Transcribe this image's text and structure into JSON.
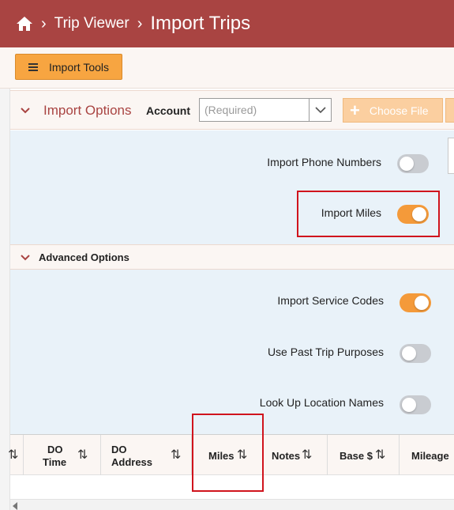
{
  "header": {
    "breadcrumb": [
      "Trip Viewer"
    ],
    "title": "Import Trips"
  },
  "toolbar": {
    "tools_label": "Import Tools"
  },
  "import_options": {
    "title": "Import Options",
    "account_label": "Account",
    "account_placeholder": "(Required)",
    "choose_file_label": "Choose File",
    "toggles": [
      {
        "label": "Import Phone Numbers",
        "on": false
      },
      {
        "label": "Import Miles",
        "on": true
      }
    ]
  },
  "advanced_options": {
    "title": "Advanced Options",
    "toggles": [
      {
        "label": "Import Service Codes",
        "on": true
      },
      {
        "label": "Use Past Trip Purposes",
        "on": false
      },
      {
        "label": "Look Up Location Names",
        "on": false
      }
    ]
  },
  "grid": {
    "columns": [
      {
        "line1": "DO",
        "line2": "Time"
      },
      {
        "line1": "DO",
        "line2": "Address"
      },
      {
        "line1": "Miles",
        "line2": ""
      },
      {
        "line1": "Notes",
        "line2": ""
      },
      {
        "line1": "Base $",
        "line2": ""
      },
      {
        "line1": "Mileage",
        "line2": ""
      }
    ],
    "sort_glyph": "⇅"
  },
  "colors": {
    "header_bg": "#a94442",
    "accent_orange": "#f7a541",
    "panel_blue": "#e9f2f9",
    "highlight_red": "#d0141d"
  }
}
